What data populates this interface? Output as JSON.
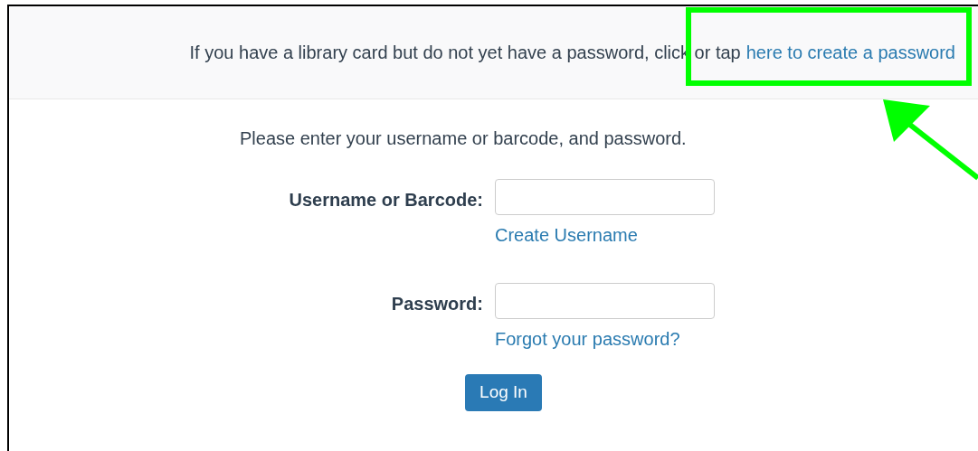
{
  "banner": {
    "text": "If you have a library card but do not yet have a password, click or tap",
    "link": "here to create a password"
  },
  "instruction": "Please enter your username or barcode, and password.",
  "fields": [
    {
      "label": "Username or Barcode:",
      "link": "Create Username"
    },
    {
      "label": "Password:",
      "link": "Forgot your password?"
    }
  ],
  "button": "Log In"
}
